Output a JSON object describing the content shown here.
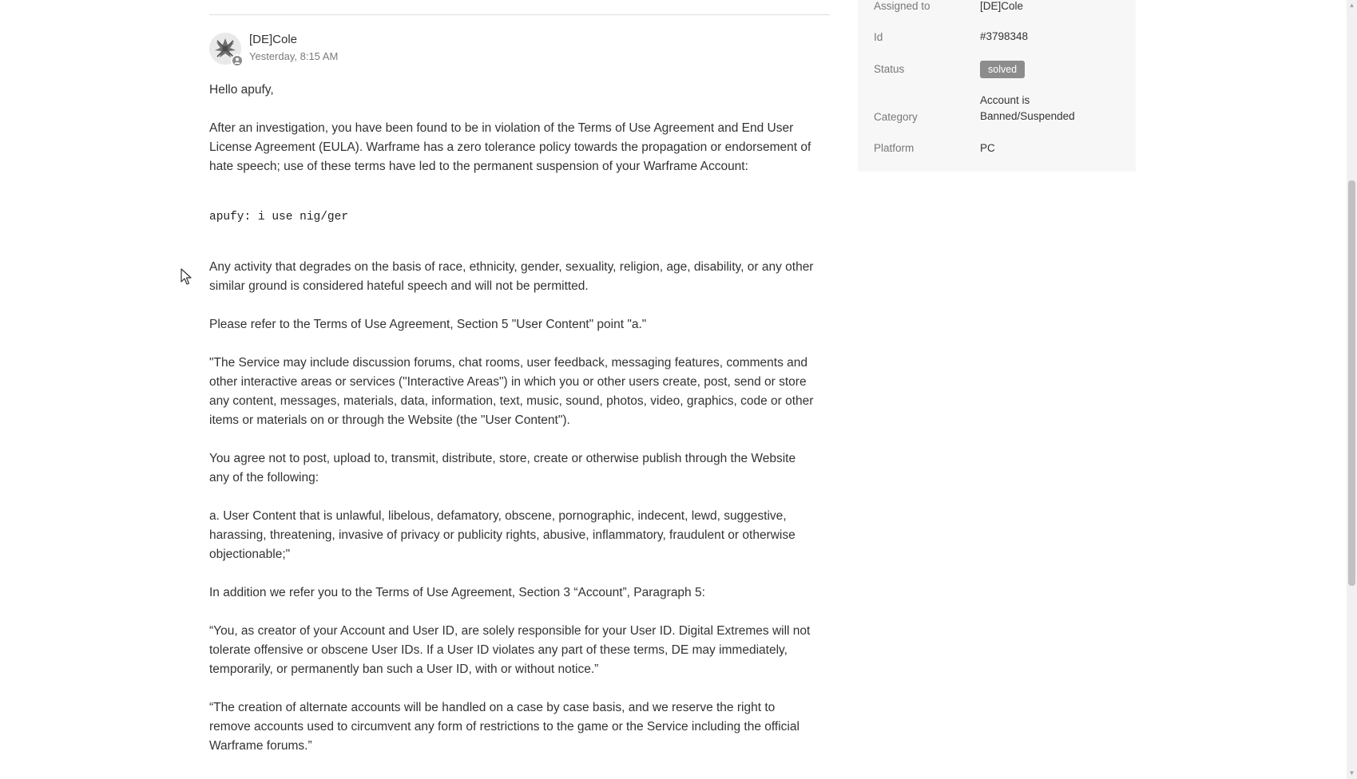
{
  "comment": {
    "author": "[DE]Cole",
    "timestamp": "Yesterday, 8:15 AM",
    "greeting": "Hello apufy,",
    "paragraph_violation": "After an investigation, you have been found to be in violation of the Terms of Use Agreement and End User License Agreement (EULA). Warframe has a zero tolerance policy towards the propagation or endorsement of hate speech; use of these terms have led to the permanent suspension of your Warframe Account:",
    "chat_quote": "apufy: i use nig/ger",
    "paragraph_activity": "Any activity that degrades on the basis of race, ethnicity, gender, sexuality, religion, age, disability, or any other similar ground is considered hateful speech and will not be permitted.",
    "paragraph_refer": "Please refer to the Terms of Use Agreement, Section 5 \"User Content\" point \"a.\"",
    "paragraph_service": "\"The Service may include discussion forums, chat rooms, user feedback, messaging features, comments and other interactive areas or services (\"Interactive Areas\") in which you or other users create, post, send or store any content, messages, materials, data, information, text, music, sound, photos, video, graphics, code or other items or materials on or through the Website (the \"User Content\").",
    "paragraph_agree": "You agree not to post, upload to, transmit, distribute, store, create or otherwise publish through the Website any of the following:",
    "paragraph_point_a": "a. User Content that is unlawful, libelous, defamatory, obscene, pornographic, indecent, lewd, suggestive, harassing, threatening, invasive of privacy or publicity rights, abusive, inflammatory, fraudulent or otherwise objectionable;\"",
    "paragraph_addition": "In addition we refer you to the Terms of Use Agreement, Section 3 “Account”, Paragraph 5:",
    "paragraph_creator": "“You, as creator of your Account and User ID, are solely responsible for your User ID. Digital Extremes will not tolerate offensive or obscene User IDs. If a User ID violates any part of these terms, DE may immediately, temporarily, or permanently ban such a User ID, with or without notice.”",
    "paragraph_alternate": "“The creation of alternate accounts will be handled on a case by case basis, and we reserve the right to remove accounts used to circumvent any form of restrictions to the game or the Service including the official Warframe forums.”"
  },
  "properties": {
    "assigned_label": "Assigned to",
    "assigned_value": "[DE]Cole",
    "id_label": "Id",
    "id_value": "#3798348",
    "status_label": "Status",
    "status_value": "solved",
    "category_label": "Category",
    "category_value_line1": "Account is",
    "category_value_line2": "Banned/Suspended",
    "platform_label": "Platform",
    "platform_value": "PC"
  },
  "colors": {
    "status_badge": "#8c8c8c",
    "sidebar_bg": "#f7f7f7",
    "text": "#333333",
    "muted": "#777777"
  }
}
